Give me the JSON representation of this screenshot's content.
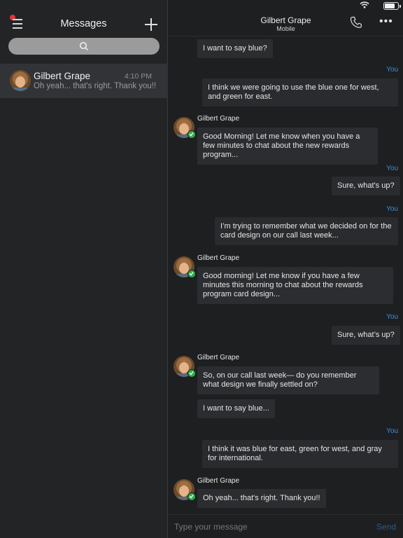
{
  "status_bar": {
    "battery_level": 0.85,
    "wifi": "wifi-icon"
  },
  "sidebar": {
    "title": "Messages",
    "menu_icon": "hamburger-menu-icon",
    "compose_icon": "plus-icon",
    "search": {
      "placeholder": "",
      "icon": "search-icon"
    },
    "conversations": [
      {
        "name": "Gilbert Grape",
        "time": "4:10 PM",
        "preview": "Oh yeah... that's right. Thank you!!",
        "selected": true
      }
    ]
  },
  "chat": {
    "contact_name": "Gilbert Grape",
    "contact_subtitle": "Mobile",
    "call_icon": "phone-icon",
    "more_icon": "more-horizontal-icon",
    "you_label": "You",
    "sender_name": "Gilbert Grape",
    "messages": [
      {
        "from": "them",
        "text": "I want to say blue?"
      },
      {
        "from": "me",
        "text": "I think we were going to use the blue one for west, and green for east."
      },
      {
        "from": "them",
        "text": "Good Morning! Let me know when you have a few minutes to chat about the new rewards program..."
      },
      {
        "from": "me",
        "text": "Sure, what's up?"
      },
      {
        "from": "me",
        "text": "I’m trying to remember what we decided on for the card design on our call last week..."
      },
      {
        "from": "them",
        "text": "Good morning! Let me know if you have a few minutes this morning to chat about the rewards program card design..."
      },
      {
        "from": "me",
        "text": "Sure, what’s up?"
      },
      {
        "from": "them",
        "text": "So, on our call last week— do you remember what design we finally settled on?"
      },
      {
        "from": "them",
        "text": "I want to say blue..."
      },
      {
        "from": "me",
        "text": "I think it was blue for east, green for west, and gray for international."
      },
      {
        "from": "them",
        "text": "Oh yeah... that's right. Thank you!!"
      }
    ],
    "composer": {
      "placeholder": "Type your message",
      "send_label": "Send"
    }
  },
  "colors": {
    "accent": "#3a8fd8",
    "presence": "#2cb24c",
    "unread_dot": "#e5333c"
  }
}
